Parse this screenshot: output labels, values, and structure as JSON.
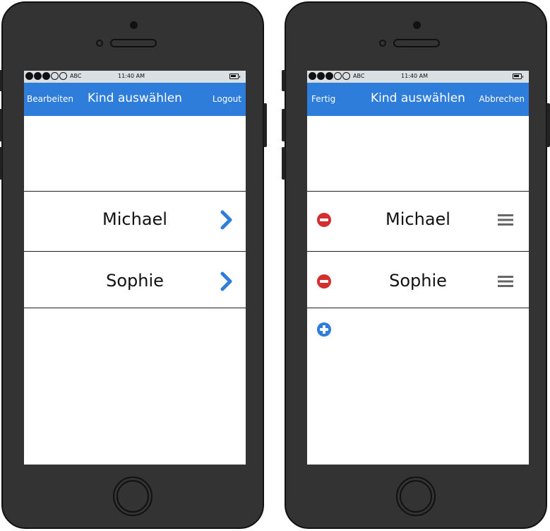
{
  "colors": {
    "nav_blue": "#2e7ddb",
    "phone_body": "#333333",
    "delete_red": "#d32f2f",
    "add_blue": "#2e7ddb",
    "chevron_blue": "#2e7ddb",
    "drag_gray": "#666666"
  },
  "left_phone": {
    "status": {
      "carrier": "ABC",
      "time": "11:40 AM"
    },
    "nav": {
      "left": "Bearbeiten",
      "title": "Kind auswählen",
      "right": "Logout"
    },
    "rows": [
      {
        "name": "Michael",
        "accessory": "chevron-right-icon"
      },
      {
        "name": "Sophie",
        "accessory": "chevron-right-icon"
      }
    ]
  },
  "right_phone": {
    "status": {
      "carrier": "ABC",
      "time": "11:40 AM"
    },
    "nav": {
      "left": "Fertig",
      "title": "Kind auswählen",
      "right": "Abbrechen"
    },
    "rows": [
      {
        "name": "Michael",
        "leading": "delete-circle-icon",
        "trailing": "drag-handle-icon"
      },
      {
        "name": "Sophie",
        "leading": "delete-circle-icon",
        "trailing": "drag-handle-icon"
      }
    ],
    "add_button": "add-circle-icon"
  }
}
